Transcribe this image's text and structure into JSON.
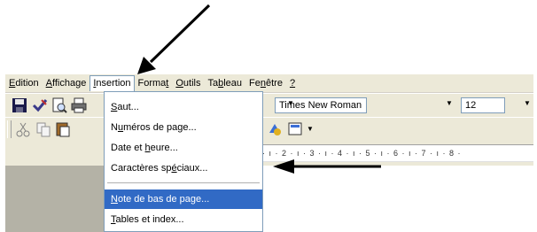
{
  "menubar": {
    "items": [
      {
        "label": "Edition",
        "key": "E"
      },
      {
        "label": "Affichage",
        "key": "A"
      },
      {
        "label": "Insertion",
        "key": "I",
        "active": true
      },
      {
        "label": "Format",
        "key": "t"
      },
      {
        "label": "Outils",
        "key": "O"
      },
      {
        "label": "Tableau",
        "key": "b"
      },
      {
        "label": "Fenêtre",
        "key": "n"
      },
      {
        "label": "?",
        "key": "?"
      }
    ]
  },
  "toolbar": {
    "font_name": "Times New Roman",
    "font_size": "12"
  },
  "ruler": {
    "text": "· ı · 2 · ı · 3 · ı · 4 · ı · 5 · ı · 6 · ı · 7 · ı · 8 ·"
  },
  "insertion_menu": {
    "items": [
      {
        "label": "Saut..."
      },
      {
        "label": "Numéros de page..."
      },
      {
        "label": "Date et heure..."
      },
      {
        "label": "Caractères spéciaux..."
      },
      {
        "label": "Note de bas de page...",
        "highlighted": true
      },
      {
        "label": "Tables et index..."
      }
    ]
  },
  "colors": {
    "highlight": "#316ac5",
    "menubar_bg": "#ece9d8",
    "gray_area": "#b4b2a6"
  }
}
